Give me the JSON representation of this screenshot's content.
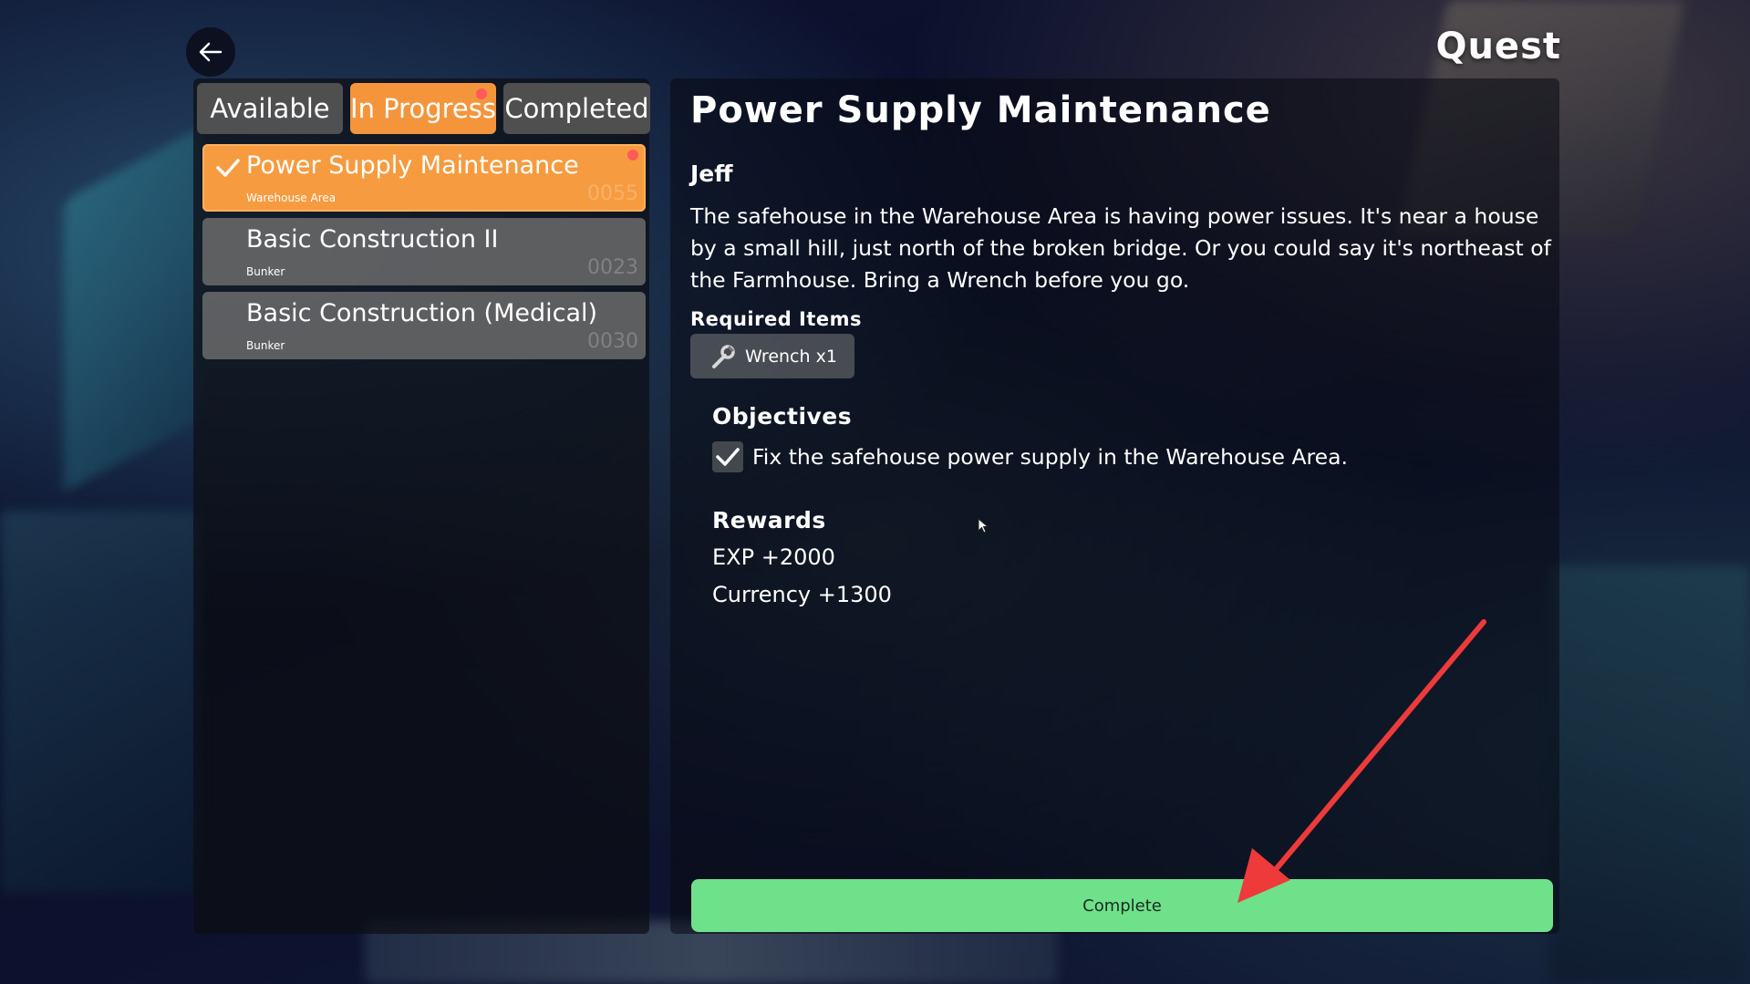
{
  "header": {
    "title": "Quest",
    "back_icon": "arrow-left-icon"
  },
  "tabs": [
    {
      "label": "Available",
      "active": false,
      "has_alert": false
    },
    {
      "label": "In Progress",
      "active": true,
      "has_alert": true
    },
    {
      "label": "Completed",
      "active": false,
      "has_alert": false
    }
  ],
  "quests": [
    {
      "name": "Power Supply Maintenance",
      "location": "Warehouse Area",
      "code": "0055",
      "selected": true,
      "completed": true
    },
    {
      "name": "Basic Construction II",
      "location": "Bunker",
      "code": "0023",
      "selected": false,
      "completed": false
    },
    {
      "name": "Basic Construction (Medical)",
      "location": "Bunker",
      "code": "0030",
      "selected": false,
      "completed": false
    }
  ],
  "detail": {
    "title": "Power Supply Maintenance",
    "giver": "Jeff",
    "description": "The safehouse in the Warehouse Area is having power issues. It's near a house by a small hill, just north of the broken bridge. Or you could say it's northeast of the Farmhouse. Bring a Wrench before you go.",
    "required_items_label": "Required Items",
    "required_items": [
      {
        "label": "Wrench x1",
        "icon": "wrench-icon"
      }
    ],
    "objectives_label": "Objectives",
    "objectives": [
      {
        "text": "Fix the safehouse power supply in the Warehouse Area.",
        "done": true
      }
    ],
    "rewards_label": "Rewards",
    "rewards": [
      "EXP +2000",
      "Currency +1300"
    ],
    "complete_label": "Complete"
  },
  "colors": {
    "active_tab": "#f4953c",
    "complete_button": "#6ee18a",
    "alert_dot": "#ff5a5a",
    "annotation_arrow": "#ee3a3a"
  }
}
